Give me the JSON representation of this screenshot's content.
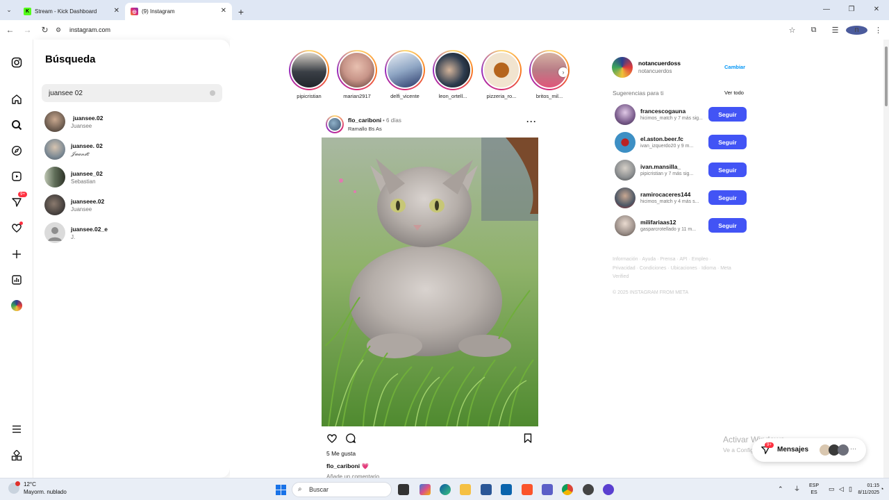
{
  "browser": {
    "tabs": [
      {
        "title": "Stream - Kick Dashboard",
        "fav": "K",
        "fav_color": "#53fc18"
      },
      {
        "title": "(9) Instagram",
        "fav": "◎",
        "fav_color": "#e1306c"
      }
    ],
    "url": "instagram.com"
  },
  "nav_icons": [
    "instagram-logo-icon",
    "home-icon",
    "search-icon",
    "explore-icon",
    "reels-icon",
    "messages-icon",
    "notifications-icon",
    "create-icon",
    "dashboard-icon",
    "profile-icon",
    "more-menu-icon",
    "also-from-meta-icon"
  ],
  "nav_badge": "9+",
  "search": {
    "title": "Búsqueda",
    "query": "juansee 02",
    "results": [
      {
        "username": "juansee.02",
        "name": "Juansee",
        "color": "#6a5a4e"
      },
      {
        "username": "juansee. 02",
        "name": "𝒥𝓊𝒶𝓃𝓈𝑒",
        "color": "#7d8a94"
      },
      {
        "username": "juansee_02",
        "name": "Sebastian",
        "color": "#5f6d58"
      },
      {
        "username": "juanseee.02",
        "name": "Juansee",
        "color": "#3e3a38"
      },
      {
        "username": "juansee.02_e",
        "name": "J.",
        "color": "#c7c7c7"
      }
    ]
  },
  "stories": [
    {
      "user": "pipicristian",
      "color": "#3a3f46"
    },
    {
      "user": "marian2917",
      "color": "#c79488"
    },
    {
      "user": "delfi_vicente",
      "color": "#8fa6c4"
    },
    {
      "user": "leon_ortell...",
      "color": "#2d3c4f"
    },
    {
      "user": "pizzeria_ro...",
      "color": "#f1e4cf"
    },
    {
      "user": "britos_mil...",
      "color": "#b97c86"
    }
  ],
  "post": {
    "user": "flo_cariboni",
    "time": "• 6 días",
    "location": "Ramallo Bs As",
    "likes": "5 Me gusta",
    "caption_user": "flo_cariboni",
    "caption_emoji": "💗",
    "comment_placeholder": "Añade un comentario..."
  },
  "me": {
    "username": "notancuerdoss",
    "name": "notancuerdos",
    "switch": "Cambiar"
  },
  "suggestions": {
    "heading": "Sugerencias para ti",
    "see_all": "Ver todo",
    "follow": "Seguir",
    "items": [
      {
        "username": "francescogauna",
        "sub": "hicimos_match y 7 más sig...",
        "color": "#7a5c8c"
      },
      {
        "username": "el.aston.beer.fc",
        "sub": "ivan_izquerdo20 y 9 m...",
        "color": "#3d8fc4"
      },
      {
        "username": "ivan.mansilla_",
        "sub": "pipicristian y 7 más sig...",
        "color": "#8a8d8f"
      },
      {
        "username": "ramirocaceres144",
        "sub": "hicimos_match y 4 más s...",
        "color": "#4d5866"
      },
      {
        "username": "milifariaas12",
        "sub": "gasparcrotellado y 11 m...",
        "color": "#9a8e88"
      }
    ]
  },
  "footer": {
    "links": "Información · Ayuda · Prensa · API · Empleo · Privacidad · Condiciones · Ubicaciones · Idioma · Meta Verified",
    "copyright": "© 2025 INSTAGRAM FROM META"
  },
  "activate": {
    "title": "Activar Windows",
    "sub": "Ve a Configuración para activar Windows."
  },
  "messages": {
    "label": "Mensajes",
    "badge": "9+"
  },
  "taskbar": {
    "weather_temp": "12°C",
    "weather_desc": "Mayorm. nublado",
    "search": "Buscar",
    "lang_top": "ESP",
    "lang_bottom": "ES",
    "time": "01:15",
    "date": "8/11/2025"
  }
}
